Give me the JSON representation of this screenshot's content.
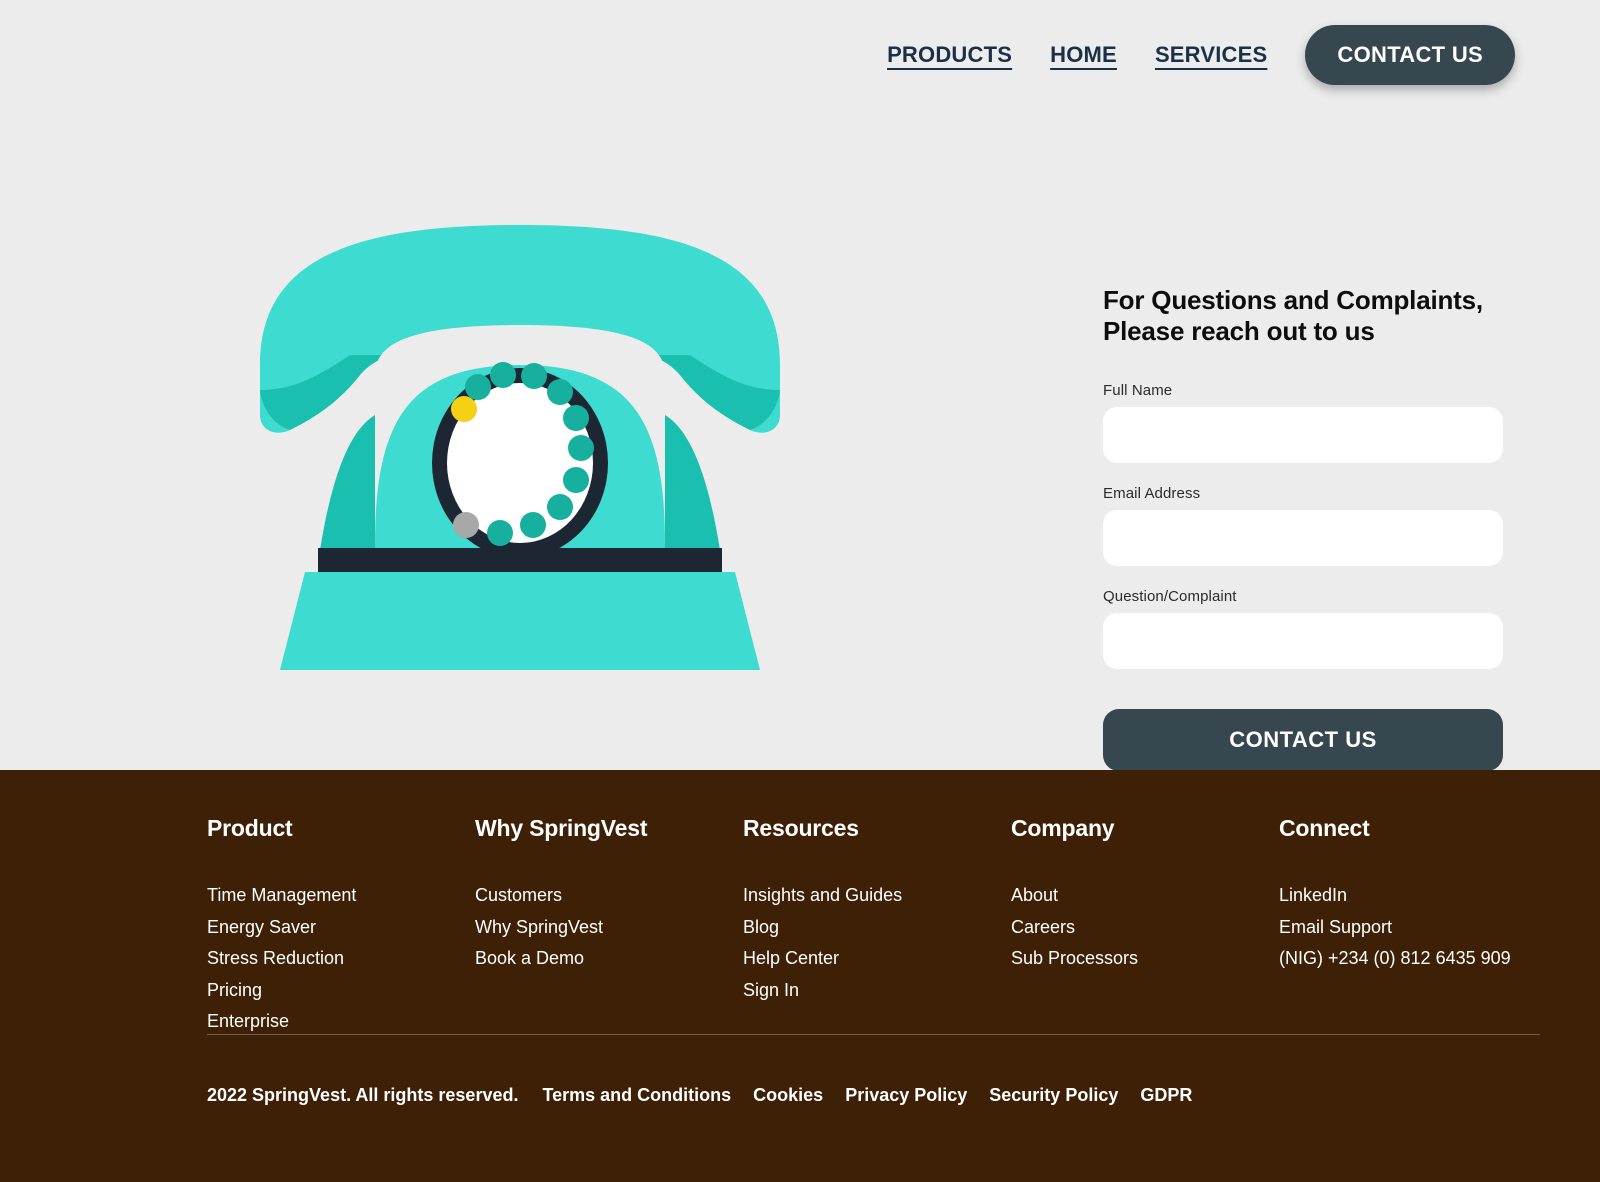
{
  "nav": {
    "links": [
      {
        "label": "PRODUCTS",
        "name": "nav-link-products"
      },
      {
        "label": "HOME",
        "name": "nav-link-home"
      },
      {
        "label": "SERVICES",
        "name": "nav-link-services"
      }
    ],
    "cta_label": "CONTACT US"
  },
  "hero": {
    "illustration": {
      "name": "rotary-telephone-illustration",
      "colors": {
        "handset_light": "#3ddbd0",
        "body_shadow": "#1bbfb0",
        "dark": "#1d2733",
        "dial_face": "#ffffff",
        "dial_dot_teal": "#17b09e",
        "dial_dot_yellow": "#f5d013",
        "dial_dot_gray": "#a8a8a8",
        "background": "#ececec"
      },
      "dial_dots": [
        {
          "angle": 200,
          "color": "yellow"
        },
        {
          "angle": 235,
          "color": "teal"
        },
        {
          "angle": 260,
          "color": "teal"
        },
        {
          "angle": 285,
          "color": "teal"
        },
        {
          "angle": 310,
          "color": "teal"
        },
        {
          "angle": 335,
          "color": "teal"
        },
        {
          "angle": 0,
          "color": "teal"
        },
        {
          "angle": 25,
          "color": "teal"
        },
        {
          "angle": 50,
          "color": "teal"
        },
        {
          "angle": 75,
          "color": "teal"
        },
        {
          "angle": 110,
          "color": "gray"
        },
        {
          "angle": 140,
          "color": "teal"
        }
      ]
    }
  },
  "form": {
    "title": "For Questions and Complaints, Please reach out to us",
    "fields": [
      {
        "label": "Full Name",
        "value": "",
        "placeholder": ""
      },
      {
        "label": "Email Address",
        "value": "",
        "placeholder": ""
      },
      {
        "label": "Question/Complaint",
        "value": "",
        "placeholder": ""
      }
    ],
    "submit_label": "CONTACT US"
  },
  "footer": {
    "columns": [
      {
        "title": "Product",
        "links": [
          "Time Management",
          "Energy Saver",
          "Stress Reduction",
          "Pricing",
          "Enterprise"
        ]
      },
      {
        "title": "Why SpringVest",
        "links": [
          "Customers",
          "Why SpringVest",
          "Book a Demo"
        ]
      },
      {
        "title": "Resources",
        "links": [
          "Insights and Guides",
          "Blog",
          "Help Center",
          "Sign In"
        ]
      },
      {
        "title": "Company",
        "links": [
          "About",
          "Careers",
          "Sub Processors"
        ]
      },
      {
        "title": "Connect",
        "links": [
          "LinkedIn",
          "Email Support",
          "(NIG) +234 (0) 812 6435 909"
        ]
      }
    ],
    "copyright": "2022 SpringVest. All rights reserved.",
    "legal_links": [
      "Terms and Conditions",
      "Cookies",
      "Privacy Policy",
      "Security Policy",
      "GDPR"
    ]
  },
  "colors": {
    "page_background": "#ececec",
    "nav_link": "#1b3047",
    "dark_slate": "#37474f",
    "footer_brown": "#3d2006",
    "accent_teal": "#3ddbd0"
  }
}
